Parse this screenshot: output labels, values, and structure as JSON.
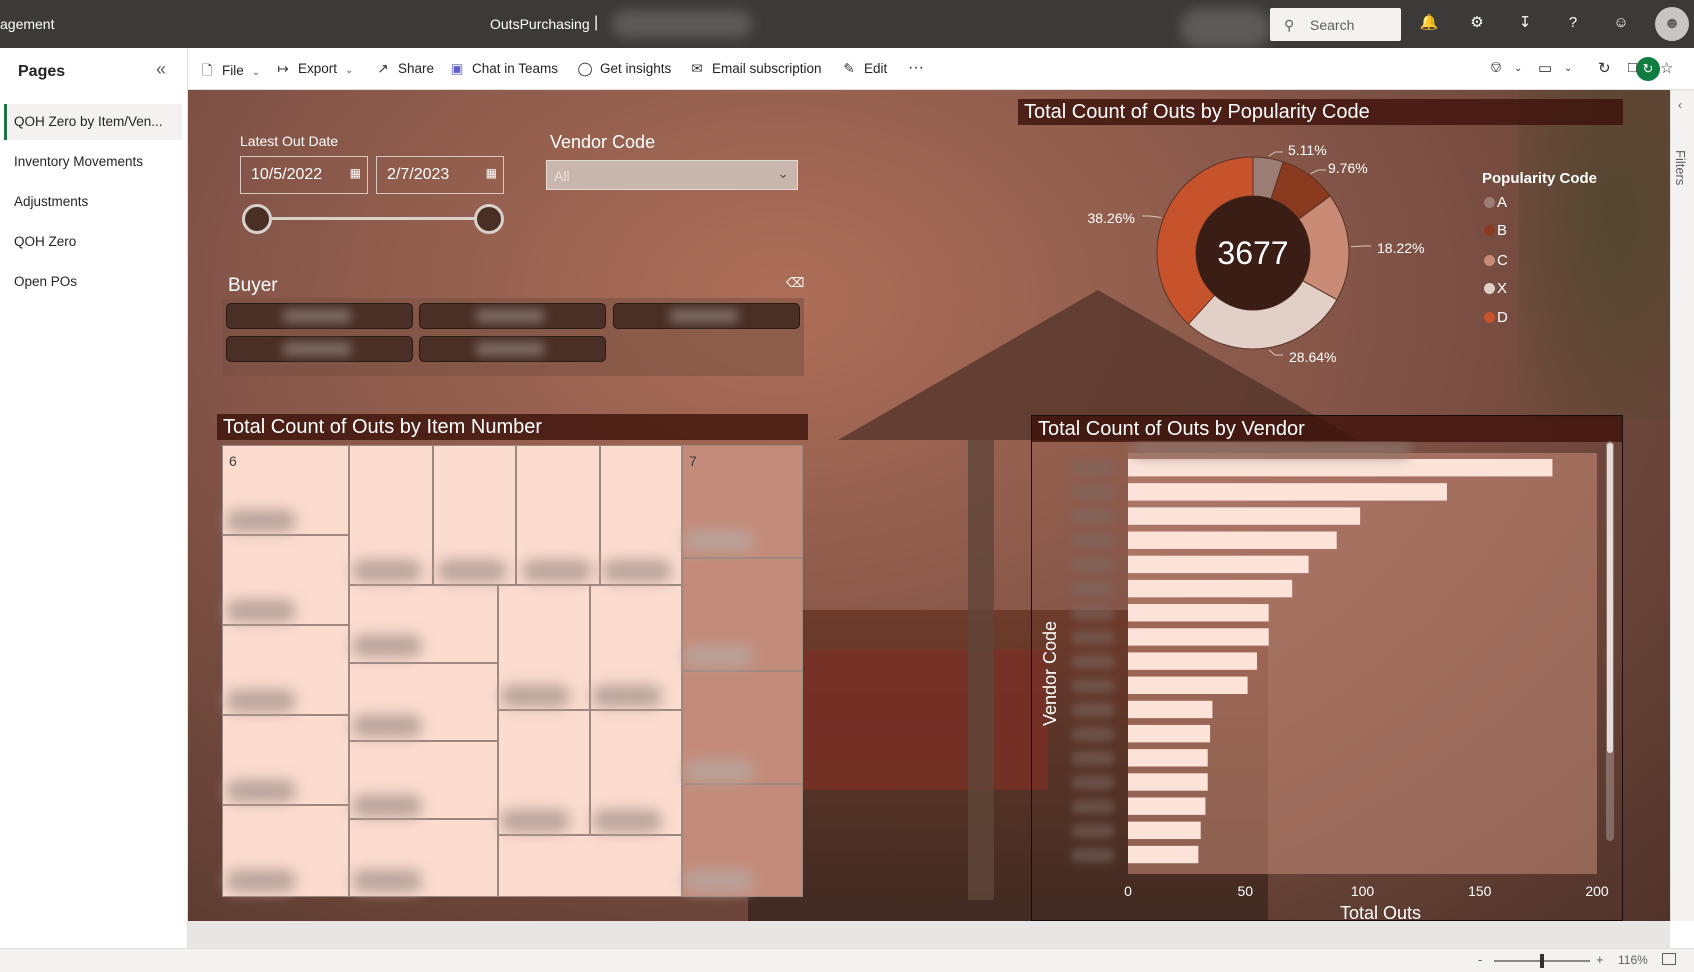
{
  "header": {
    "app_title": "agement",
    "report_title": "OutsPurchasing",
    "separator": "|",
    "search_placeholder": "Search"
  },
  "pages_panel": {
    "title": "Pages",
    "items": [
      {
        "label": "QOH Zero by Item/Ven...",
        "active": true
      },
      {
        "label": "Inventory Movements",
        "active": false
      },
      {
        "label": "Adjustments",
        "active": false
      },
      {
        "label": "QOH Zero",
        "active": false
      },
      {
        "label": "Open POs",
        "active": false
      }
    ]
  },
  "toolbar": {
    "file": "File",
    "export": "Export",
    "share": "Share",
    "chat_in_teams": "Chat in Teams",
    "get_insights": "Get insights",
    "email_subscription": "Email subscription",
    "edit": "Edit",
    "more": "···"
  },
  "filters_pane": {
    "label": "Filters"
  },
  "status_bar": {
    "zoom": "116%",
    "minus": "-",
    "plus": "+"
  },
  "slicers": {
    "date": {
      "label": "Latest Out Date",
      "start": "10/5/2022",
      "end": "2/7/2023"
    },
    "vendor": {
      "label": "Vendor Code",
      "value": "All"
    },
    "buyer": {
      "label": "Buyer"
    }
  },
  "treemap": {
    "title": "Total Count of Outs by Item Number",
    "group_labels": [
      "6",
      "7"
    ]
  },
  "donut": {
    "title": "Total Count of Outs by Popularity Code",
    "total": "3677",
    "legend_title": "Popularity Code",
    "colors": {
      "A": "#9b7d73",
      "B": "#8a3a1f",
      "C": "#c98a76",
      "X": "#e2cfc7",
      "D": "#c6532b"
    }
  },
  "chart_data": [
    {
      "type": "pie",
      "title": "Total Count of Outs by Popularity Code",
      "total": 3677,
      "legend_title": "Popularity Code",
      "slices": [
        {
          "name": "A",
          "value": 5.11,
          "label": "5.11%"
        },
        {
          "name": "B",
          "value": 9.76,
          "label": "9.76%"
        },
        {
          "name": "C",
          "value": 18.22,
          "label": "18.22%"
        },
        {
          "name": "X",
          "value": 28.64,
          "label": "28.64%"
        },
        {
          "name": "D",
          "value": 38.26,
          "label": "38.26%"
        }
      ]
    },
    {
      "type": "bar",
      "orientation": "horizontal",
      "title": "Total Count of Outs by Vendor",
      "xlabel": "Total Outs",
      "ylabel": "Vendor Code",
      "xlim": [
        0,
        200
      ],
      "xticks": [
        "0",
        "50",
        "100",
        "150",
        "200"
      ],
      "values": [
        181,
        136,
        99,
        89,
        77,
        70,
        60,
        60,
        55,
        51,
        36,
        35,
        34,
        34,
        33,
        31,
        30
      ]
    }
  ]
}
